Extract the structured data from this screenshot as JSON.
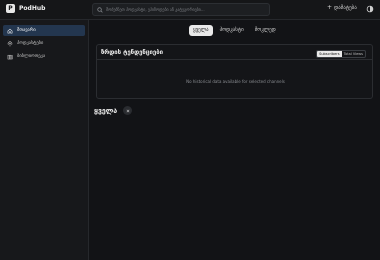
{
  "app": {
    "name": "PodHub",
    "logo_letter": "P"
  },
  "search": {
    "placeholder": "მოძებნეთ პოდკასტი, ეპიზოდები ან კატეგორიები..."
  },
  "header": {
    "add_label": "დამატება"
  },
  "sidebar": {
    "items": [
      {
        "label": "მთავარი",
        "icon": "home-icon",
        "active": true
      },
      {
        "label": "პოდკასტები",
        "icon": "podcast-icon",
        "active": false
      },
      {
        "label": "ბიბლიოთეკა",
        "icon": "library-icon",
        "active": false
      }
    ]
  },
  "tabs": [
    {
      "label": "ყველა",
      "active": true
    },
    {
      "label": "პოდკასტი",
      "active": false
    },
    {
      "label": "მოკლედ",
      "active": false
    }
  ],
  "trends": {
    "title": "ზრდის ტენდენციები",
    "toggle": [
      {
        "label": "Subscribers",
        "active": true
      },
      {
        "label": "Total Views",
        "active": false
      }
    ],
    "empty_message": "No historical data available for selected channels"
  },
  "filter": {
    "label": "ყველა"
  },
  "colors": {
    "accent": "#23364f",
    "background": "#121316"
  }
}
